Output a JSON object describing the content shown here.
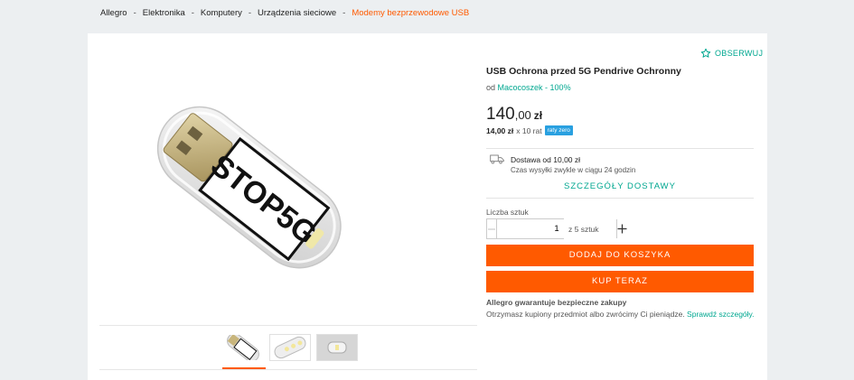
{
  "breadcrumb": [
    "Allegro",
    "Elektronika",
    "Komputery",
    "Urządzenia sieciowe",
    "Modemy bezprzewodowe USB"
  ],
  "breadcrumb_separator": "-",
  "product_image_text": "STOP5G",
  "watch": {
    "label": "OBSERWUJ"
  },
  "product": {
    "title": "USB Ochrona przed 5G Pendrive Ochronny",
    "seller_prefix": "od",
    "seller_name": "Macocoszek - 100%"
  },
  "price": {
    "integer": "140",
    "decimal": ",00",
    "currency": "zł",
    "installment_amount": "14,00 zł",
    "installment_count": "x 10 rat",
    "installment_badge": "raty zero"
  },
  "delivery": {
    "title": "Dostawa od 10,00 zł",
    "subtitle": "Czas wysyłki zwykle w ciągu 24 godzin",
    "details_link": "SZCZEGÓŁY DOSTAWY"
  },
  "quantity": {
    "label": "Liczba sztuk",
    "value": "1",
    "stock": "z 5 sztuk"
  },
  "buttons": {
    "add_to_cart": "DODAJ DO KOSZYKA",
    "buy_now": "KUP TERAZ"
  },
  "guarantee": {
    "title": "Allegro gwarantuje bezpieczne zakupy",
    "text": "Otrzymasz kupiony przedmiot albo zwrócimy Ci pieniądze.",
    "link": "Sprawdź szczegóły."
  },
  "colors": {
    "accent_orange": "#ff5a00",
    "link_teal": "#00a790",
    "badge_blue": "#29a0e0"
  }
}
